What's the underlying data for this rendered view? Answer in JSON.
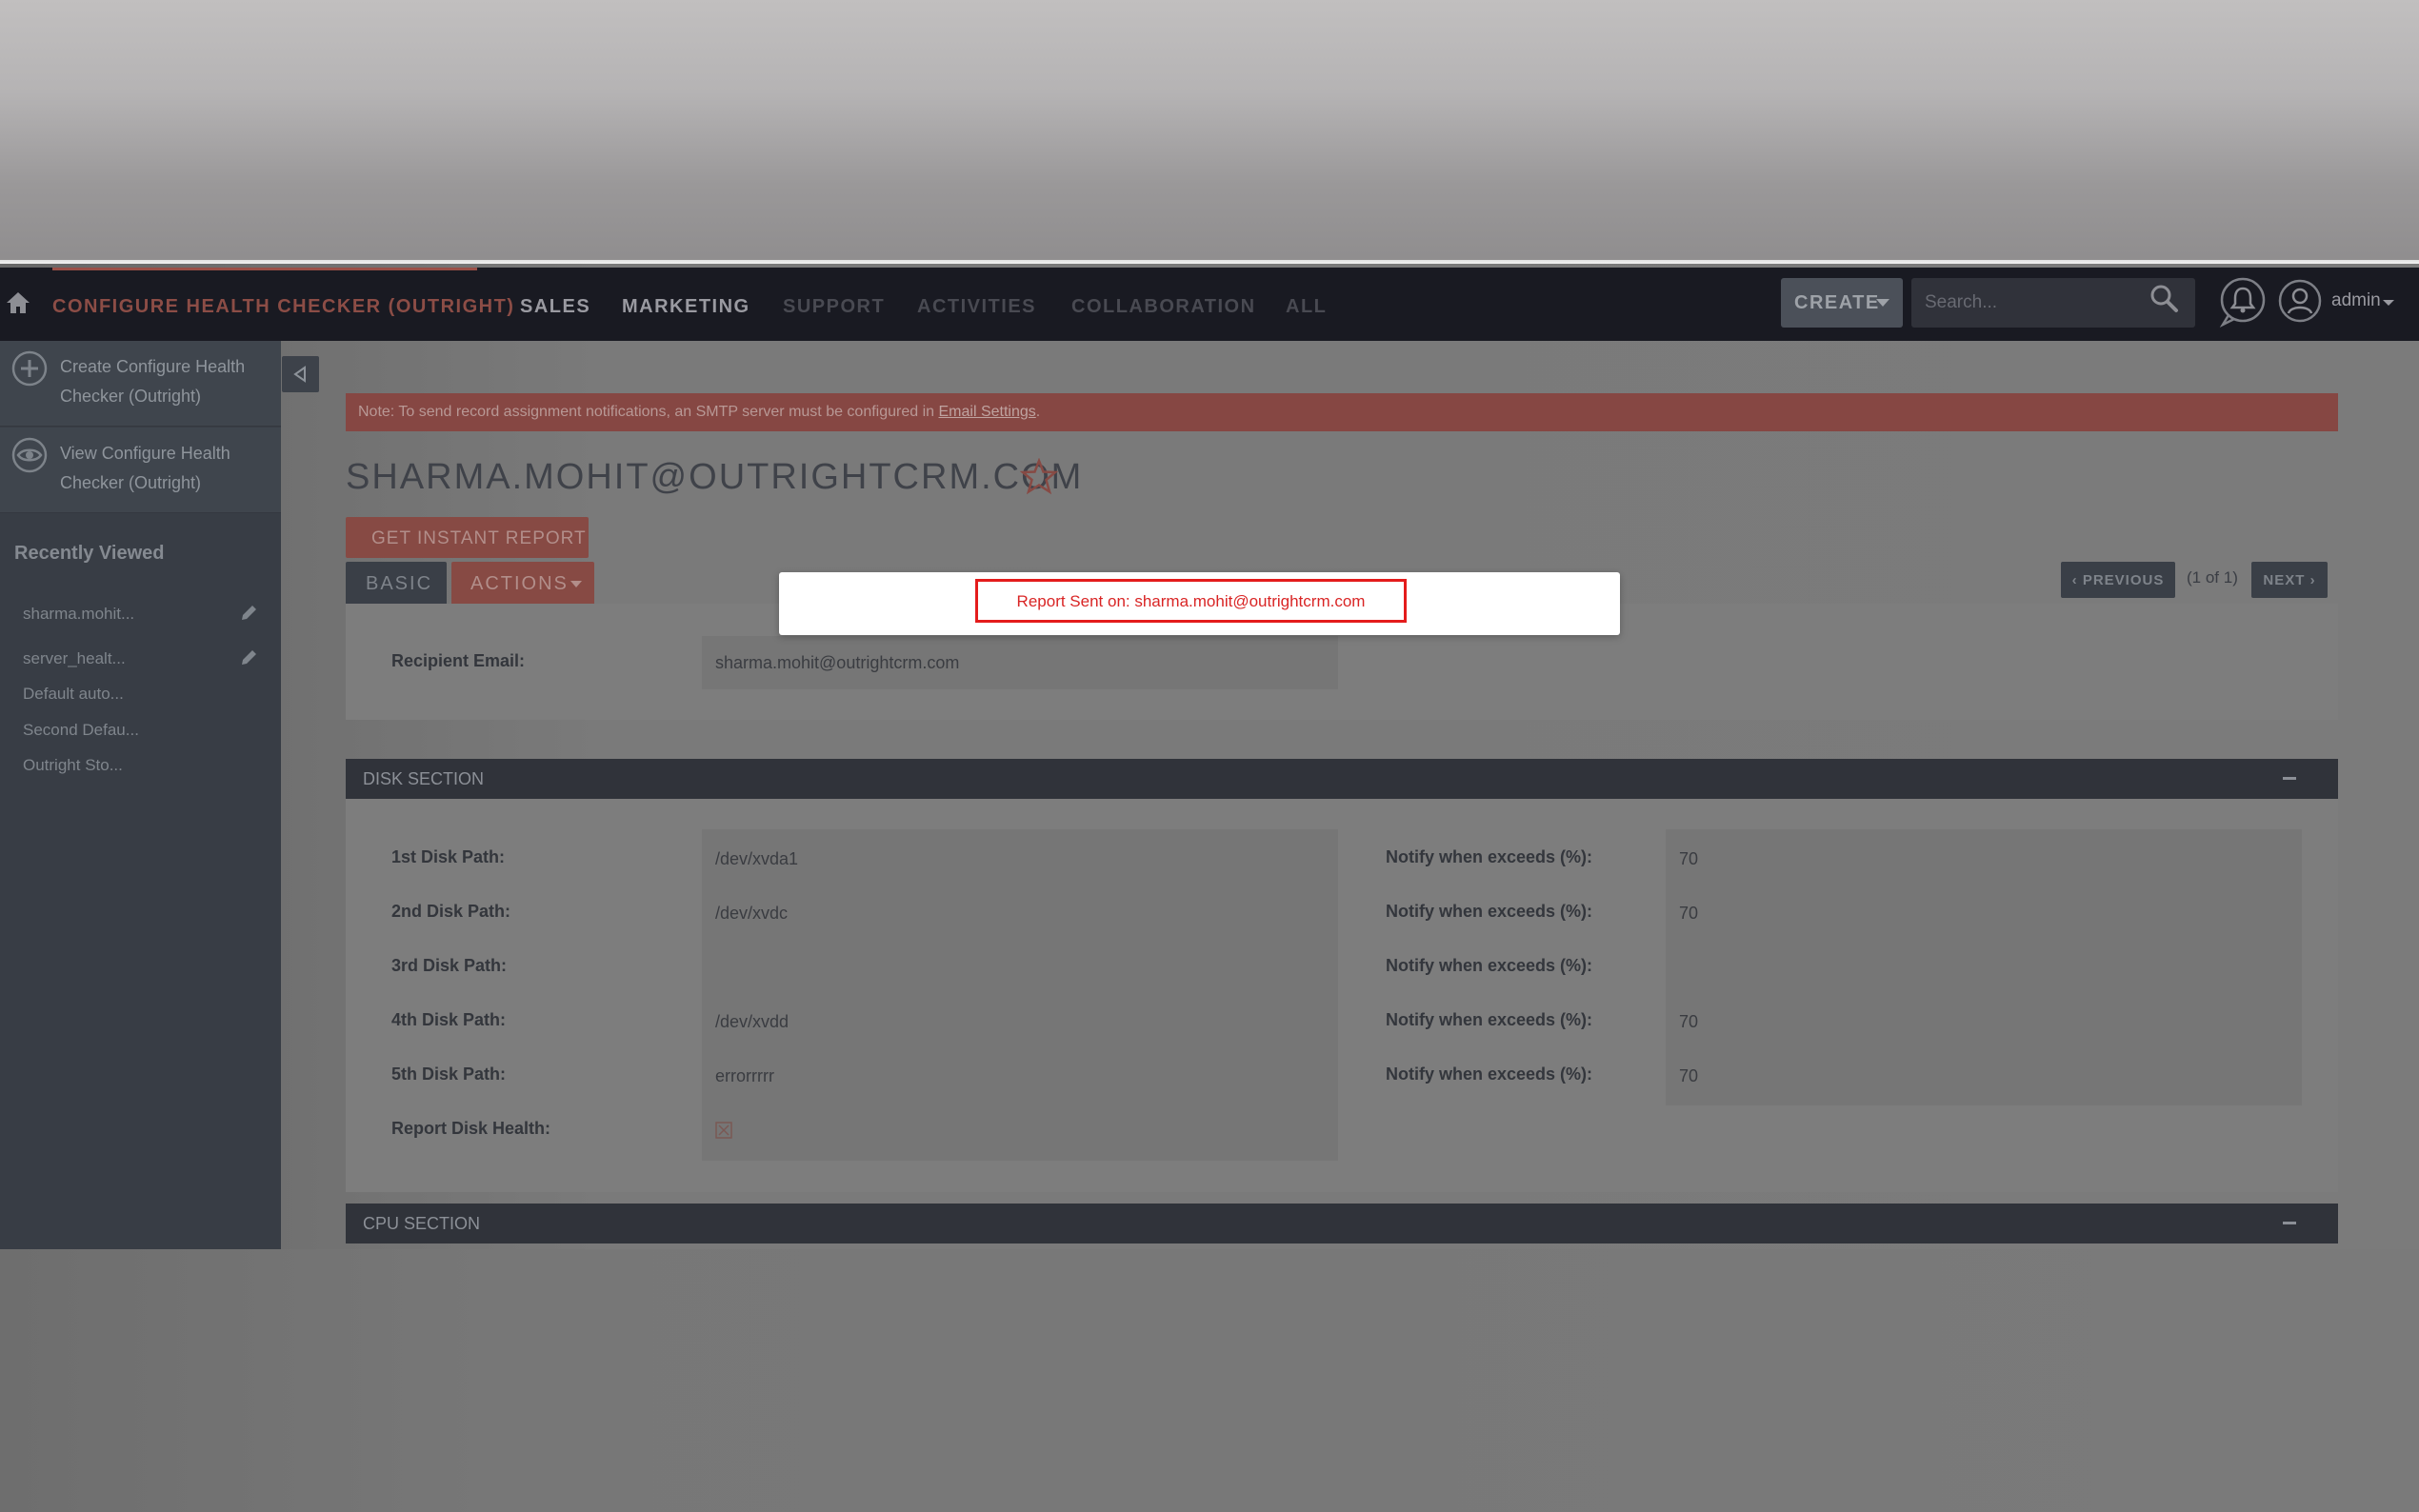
{
  "topnav": {
    "items": [
      {
        "label": "CONFIGURE HEALTH CHECKER (OUTRIGHT)",
        "active": true
      },
      {
        "label": "SALES"
      },
      {
        "label": "MARKETING"
      },
      {
        "label": "SUPPORT"
      },
      {
        "label": "ACTIVITIES"
      },
      {
        "label": "COLLABORATION"
      },
      {
        "label": "ALL"
      }
    ],
    "create_label": "CREATE",
    "search_placeholder": "Search...",
    "user_label": "admin"
  },
  "sidebar": {
    "actions": [
      {
        "label": "Create Configure Health Checker (Outright)",
        "icon": "plus-circle-icon"
      },
      {
        "label": "View Configure Health Checker (Outright)",
        "icon": "eye-icon"
      }
    ],
    "recent_title": "Recently Viewed",
    "recent_items": [
      {
        "label": "sharma.mohit...",
        "editable": true
      },
      {
        "label": "server_healt...",
        "editable": true
      },
      {
        "label": "Default auto...",
        "editable": false
      },
      {
        "label": "Second Defau...",
        "editable": false
      },
      {
        "label": "Outright Sto...",
        "editable": false
      }
    ]
  },
  "notice": {
    "text": "Note: To send record assignment notifications, an SMTP server must be configured in ",
    "link": "Email Settings",
    "suffix": "."
  },
  "record": {
    "title": "SHARMA.MOHIT@OUTRIGHTCRM.COM",
    "instant_report_label": "GET INSTANT REPORT",
    "tab_basic": "BASIC",
    "tab_actions": "ACTIONS",
    "pager": {
      "previous": "PREVIOUS",
      "count": "(1 of 1)",
      "next": "NEXT"
    },
    "recipient_label": "Recipient Email:",
    "recipient_value": "sharma.mohit@outrightcrm.com"
  },
  "disk_section": {
    "title": "DISK SECTION",
    "rows": [
      {
        "label": "1st Disk Path:",
        "value": "/dev/xvda1",
        "notify_label": "Notify when exceeds (%):",
        "notify_value": "70"
      },
      {
        "label": "2nd Disk Path:",
        "value": "/dev/xvdc",
        "notify_label": "Notify when exceeds (%):",
        "notify_value": "70"
      },
      {
        "label": "3rd Disk Path:",
        "value": "",
        "notify_label": "Notify when exceeds (%):",
        "notify_value": ""
      },
      {
        "label": "4th Disk Path:",
        "value": "/dev/xvdd",
        "notify_label": "Notify when exceeds (%):",
        "notify_value": "70"
      },
      {
        "label": "5th Disk Path:",
        "value": "errorrrrr",
        "notify_label": "Notify when exceeds (%):",
        "notify_value": "70"
      }
    ],
    "report_label": "Report Disk Health:",
    "report_checked": false
  },
  "cpu_section": {
    "title": "CPU SECTION"
  },
  "modal": {
    "message": "Report Sent on: sharma.mohit@outrightcrm.com"
  },
  "colors": {
    "accent": "#874a44",
    "nav_bg": "#191a22",
    "sidebar_bg": "#383d45",
    "modal_border": "#e41c1c"
  }
}
